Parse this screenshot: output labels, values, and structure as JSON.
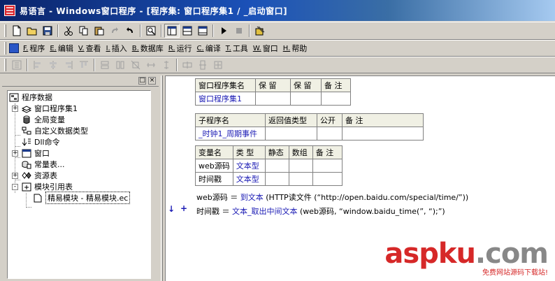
{
  "window": {
    "title": "易语言 - Windows窗口程序 - [程序集: 窗口程序集1 / _启动窗口]"
  },
  "menu": [
    {
      "key": "F.",
      "label": "程序"
    },
    {
      "key": "E.",
      "label": "编辑"
    },
    {
      "key": "V.",
      "label": "查看"
    },
    {
      "key": "I.",
      "label": "插入"
    },
    {
      "key": "B.",
      "label": "数据库"
    },
    {
      "key": "R.",
      "label": "运行"
    },
    {
      "key": "C.",
      "label": "编译"
    },
    {
      "key": "T.",
      "label": "工具"
    },
    {
      "key": "W.",
      "label": "窗口"
    },
    {
      "key": "H.",
      "label": "帮助"
    }
  ],
  "tree": {
    "root": "程序数据",
    "items": [
      {
        "label": "窗口程序集1",
        "expander": "+"
      },
      {
        "label": "全局变量",
        "expander": ""
      },
      {
        "label": "自定义数据类型",
        "expander": ""
      },
      {
        "label": "Dll命令",
        "expander": ""
      },
      {
        "label": "窗口",
        "expander": "+"
      },
      {
        "label": "常量表...",
        "expander": ""
      },
      {
        "label": "资源表",
        "expander": "+"
      },
      {
        "label": "模块引用表",
        "expander": "-"
      },
      {
        "label": "精易模块 - 精易模块.ec",
        "expander": ""
      }
    ]
  },
  "assembly_table": {
    "headers": [
      "窗口程序集名",
      "保 留",
      "保 留",
      "备 注"
    ],
    "row": [
      "窗口程序集1",
      "",
      "",
      ""
    ]
  },
  "sub_table": {
    "headers": [
      "子程序名",
      "返回值类型",
      "公开",
      "备 注"
    ],
    "row": [
      "_时钟1_周期事件",
      "",
      "",
      ""
    ]
  },
  "var_table": {
    "headers": [
      "变量名",
      "类 型",
      "静态",
      "数组",
      "备 注"
    ],
    "rows": [
      [
        "web源码",
        "文本型",
        "",
        "",
        ""
      ],
      [
        "时间戳",
        "文本型",
        "",
        "",
        ""
      ]
    ]
  },
  "code": {
    "line1": {
      "var": "web源码",
      "eq": "＝",
      "func": "到文本",
      "inner": "(HTTP读文件 (“http://open.baidu.com/special/time/”))"
    },
    "line2": {
      "var": "时间戳",
      "eq": "＝",
      "func": "文本_取出中间文本",
      "inner": "(web源码, “window.baidu_time(”, “);”)"
    },
    "markers": {
      "arrow": "↓",
      "plus": "+"
    }
  },
  "watermark": {
    "main_a": "asp",
    "main_b": "ku",
    "main_c": ".com",
    "sub": "免费网站源码下载站!"
  }
}
